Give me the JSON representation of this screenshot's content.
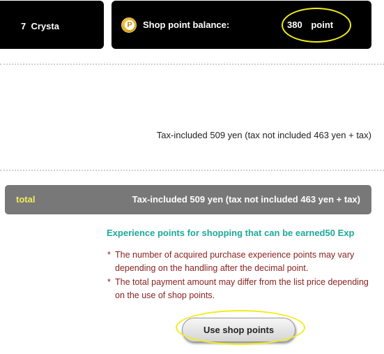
{
  "header": {
    "crystal_count": "7",
    "crystal_label": "Crysta",
    "point_icon_letter": "P",
    "shop_point_label": "Shop point balance:",
    "shop_point_value": "380",
    "shop_point_unit": "point"
  },
  "summary": {
    "tax_line": "Tax-included 509 yen (tax not included 463 yen + tax)"
  },
  "total": {
    "label": "total",
    "value": "Tax-included 509 yen (tax not included 463 yen + tax)"
  },
  "experience": {
    "text": "Experience points for shopping that can be earned50 Exp"
  },
  "notes": [
    {
      "mark": "*",
      "text": "The number of acquired purchase experience points may vary depending on the handling after the decimal point."
    },
    {
      "mark": "*",
      "text": "The total payment amount may differ from the list price depending on the use of shop points."
    }
  ],
  "actions": {
    "use_shop_points_label": "Use shop points"
  },
  "colors": {
    "panel_background": "#000000",
    "total_bar": "#787878",
    "total_label": "#f2ec5a",
    "experience_text": "#1fa89a",
    "note_text": "#8a1e1e",
    "highlight": "#f2ec1a",
    "point_icon": "#e0a820"
  }
}
